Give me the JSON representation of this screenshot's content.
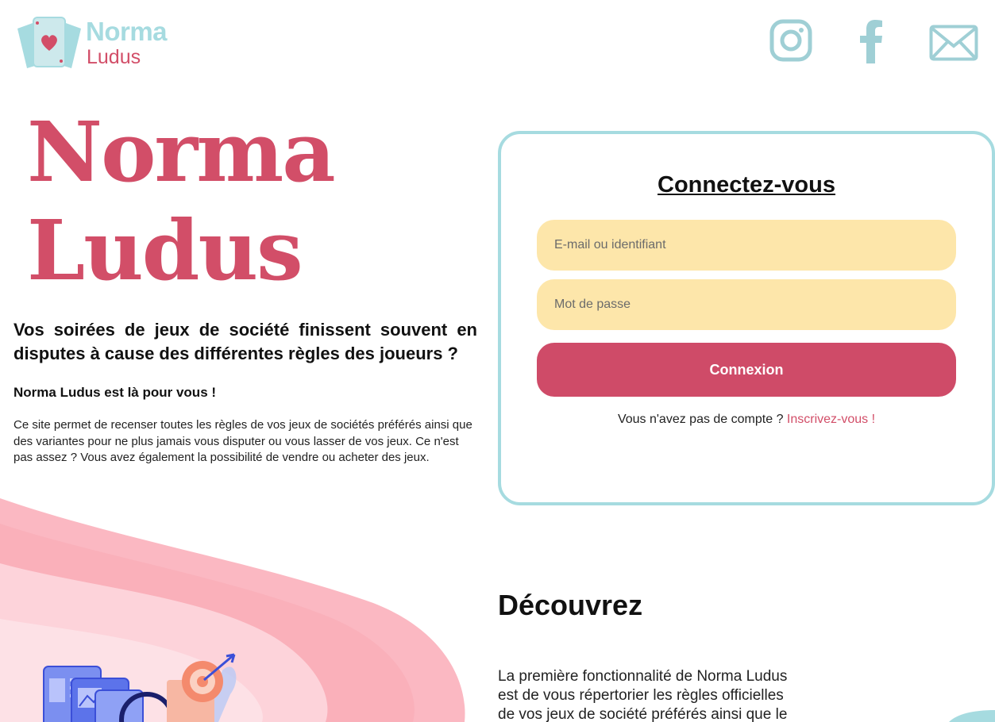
{
  "header": {
    "logo_title": "Norma",
    "logo_subtitle": "Ludus",
    "social": [
      {
        "icon": "instagram-icon"
      },
      {
        "icon": "facebook-icon"
      },
      {
        "icon": "mail-icon"
      }
    ]
  },
  "hero": {
    "title_line1": "Norma",
    "title_line2": "Ludus",
    "tagline": "Vos soirées de jeux de société finissent souvent en disputes à cause des différentes règles des joueurs ?",
    "lead": "Norma Ludus est là pour vous !",
    "description": "Ce site permet de recenser toutes les règles de vos jeux de sociétés préférés ainsi que des variantes pour ne plus jamais vous disputer ou vous lasser de vos jeux. Ce n'est pas assez ? Vous avez également la possibilité de vendre ou acheter des jeux."
  },
  "login": {
    "title": "Connectez-vous",
    "email_placeholder": "E-mail ou identifiant",
    "password_placeholder": "Mot de passe",
    "submit_label": "Connexion",
    "no_account_text": "Vous n'avez pas de compte ? ",
    "signup_link": "Inscrivez-vous !"
  },
  "discover": {
    "title": "Découvrez",
    "text": "La première fonctionnalité de Norma Ludus est de vous répertorier les règles officielles de vos jeux de société préférés ainsi que le"
  },
  "colors": {
    "accent_pink": "#d24e68",
    "accent_teal": "#a6dbe0",
    "input_yellow": "#fde6aa",
    "wave_pink": "#fbb8c2"
  }
}
